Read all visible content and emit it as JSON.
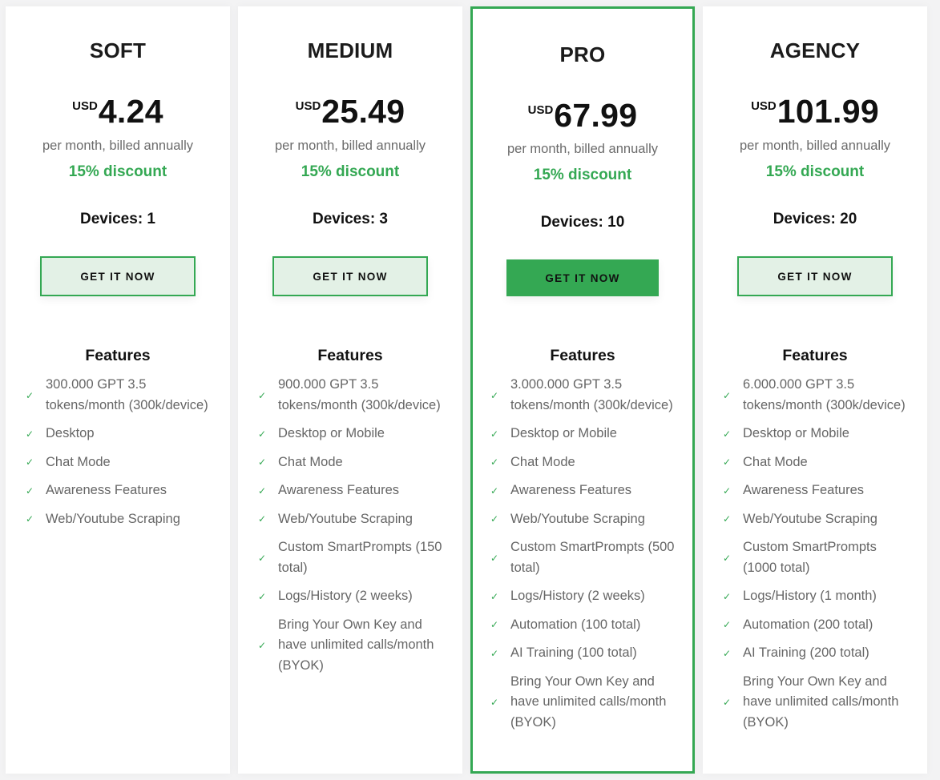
{
  "accent_color": "#34a853",
  "plans": [
    {
      "name": "SOFT",
      "currency": "USD",
      "price": "4.24",
      "period": "per month, billed annually",
      "discount": "15% discount",
      "devices": "Devices: 1",
      "button_label": "GET IT NOW",
      "highlighted": false,
      "features_heading": "Features",
      "features": [
        "300.000 GPT 3.5 tokens/month (300k/device)",
        "Desktop",
        "Chat Mode",
        "Awareness Features",
        "Web/Youtube Scraping"
      ]
    },
    {
      "name": "MEDIUM",
      "currency": "USD",
      "price": "25.49",
      "period": "per month, billed annually",
      "discount": "15% discount",
      "devices": "Devices: 3",
      "button_label": "GET IT NOW",
      "highlighted": false,
      "features_heading": "Features",
      "features": [
        "900.000 GPT 3.5 tokens/month (300k/device)",
        "Desktop or Mobile",
        "Chat Mode",
        "Awareness Features",
        "Web/Youtube Scraping",
        "Custom SmartPrompts (150 total)",
        "Logs/History (2 weeks)",
        "Bring Your Own Key and have unlimited calls/month (BYOK)"
      ]
    },
    {
      "name": "PRO",
      "currency": "USD",
      "price": "67.99",
      "period": "per month, billed annually",
      "discount": "15% discount",
      "devices": "Devices: 10",
      "button_label": "GET IT NOW",
      "highlighted": true,
      "features_heading": "Features",
      "features": [
        "3.000.000 GPT 3.5 tokens/month (300k/device)",
        "Desktop or Mobile",
        "Chat Mode",
        "Awareness Features",
        "Web/Youtube Scraping",
        "Custom SmartPrompts (500 total)",
        "Logs/History (2 weeks)",
        "Automation (100 total)",
        "AI Training (100 total)",
        "Bring Your Own Key and have unlimited calls/month (BYOK)"
      ]
    },
    {
      "name": "AGENCY",
      "currency": "USD",
      "price": "101.99",
      "period": "per month, billed annually",
      "discount": "15% discount",
      "devices": "Devices: 20",
      "button_label": "GET IT NOW",
      "highlighted": false,
      "features_heading": "Features",
      "features": [
        "6.000.000 GPT 3.5 tokens/month (300k/device)",
        "Desktop or Mobile",
        "Chat Mode",
        "Awareness Features",
        "Web/Youtube Scraping",
        "Custom SmartPrompts (1000 total)",
        "Logs/History (1 month)",
        "Automation (200 total)",
        "AI Training (200 total)",
        "Bring Your Own Key and have unlimited calls/month (BYOK)"
      ]
    }
  ]
}
